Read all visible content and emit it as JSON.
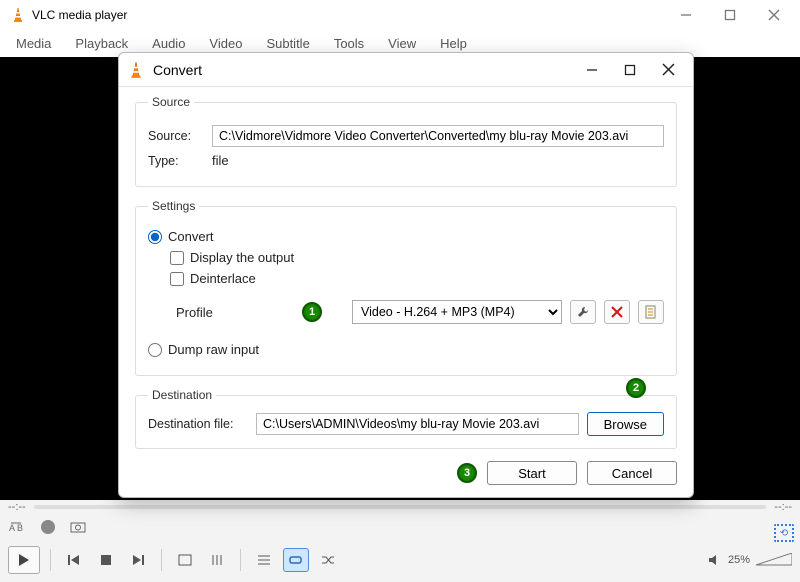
{
  "app": {
    "title": "VLC media player",
    "menu": [
      "Media",
      "Playback",
      "Audio",
      "Video",
      "Subtitle",
      "Tools",
      "View",
      "Help"
    ],
    "timeline": {
      "left": "--:--",
      "right": "--:--"
    },
    "volume": "25%"
  },
  "dialog": {
    "title": "Convert",
    "source": {
      "legend": "Source",
      "source_label": "Source:",
      "source_value": "C:\\Vidmore\\Vidmore Video Converter\\Converted\\my blu-ray Movie 203.avi",
      "type_label": "Type:",
      "type_value": "file"
    },
    "settings": {
      "legend": "Settings",
      "convert_label": "Convert",
      "display_output_label": "Display the output",
      "deinterlace_label": "Deinterlace",
      "profile_label": "Profile",
      "profile_selected": "Video - H.264 + MP3 (MP4)",
      "dump_raw_label": "Dump raw input"
    },
    "destination": {
      "legend": "Destination",
      "dest_label": "Destination file:",
      "dest_value": "C:\\Users\\ADMIN\\Videos\\my blu-ray Movie 203.avi",
      "browse_label": "Browse"
    },
    "actions": {
      "start": "Start",
      "cancel": "Cancel"
    }
  },
  "badges": {
    "b1": "1",
    "b2": "2",
    "b3": "3"
  }
}
